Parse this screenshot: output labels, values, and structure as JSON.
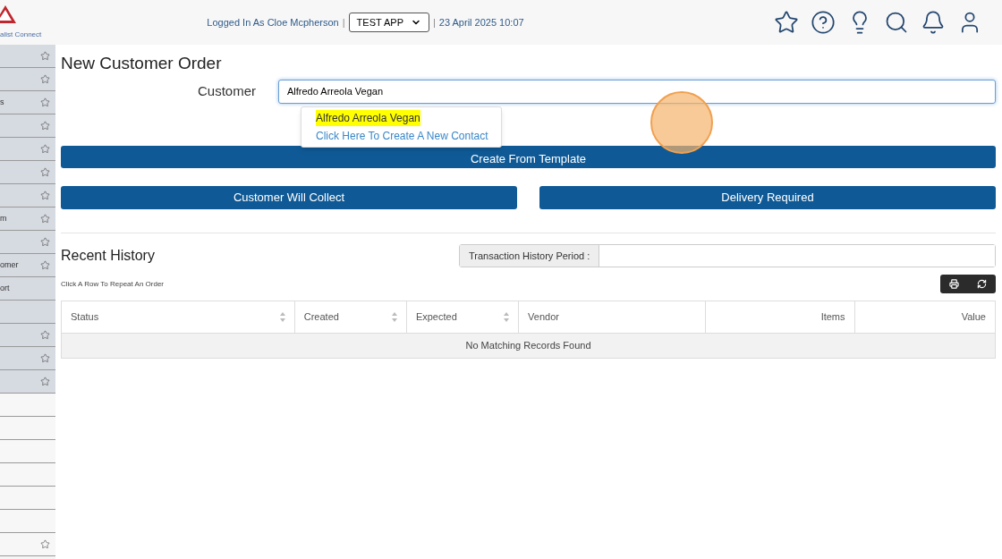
{
  "header": {
    "logo_caption": "alist Connect",
    "logged_in": "Logged In As Cloe Mcpherson",
    "separator_1": "|",
    "app_select": "TEST APP",
    "separator_2": "|",
    "datetime": "23 April 2025 10:07"
  },
  "sidebar": {
    "items": [
      {
        "shaded": true,
        "star": true
      },
      {
        "shaded": true,
        "star": true
      },
      {
        "label": "s",
        "shaded": true,
        "star": true
      },
      {
        "shaded": true,
        "star": true
      },
      {
        "shaded": true,
        "star": true
      },
      {
        "shaded": true,
        "star": true
      },
      {
        "shaded": true,
        "star": true
      },
      {
        "label": "m",
        "shaded": true,
        "star": true
      },
      {
        "shaded": true,
        "star": true
      },
      {
        "label": "omer",
        "shaded": true,
        "star": true
      },
      {
        "label": "ort",
        "shaded": true,
        "star": false
      },
      {
        "shaded": true,
        "star": false
      },
      {
        "shaded": true,
        "star": true
      },
      {
        "shaded": true,
        "star": true
      },
      {
        "shaded": true,
        "star": true
      },
      {
        "shaded": false,
        "star": false
      },
      {
        "shaded": false,
        "star": false
      },
      {
        "shaded": false,
        "star": false
      },
      {
        "shaded": false,
        "star": false
      },
      {
        "shaded": false,
        "star": false
      },
      {
        "shaded": false,
        "star": false
      },
      {
        "shaded": false,
        "star": true
      }
    ]
  },
  "page": {
    "title": "New Customer Order",
    "customer_label": "Customer",
    "customer_value": "Alfredo Arreola Vegan",
    "suggestions": [
      {
        "label": "Alfredo Arreola Vegan",
        "selected": true
      },
      {
        "label": "Click Here To Create A New Contact",
        "selected": false
      }
    ],
    "template_button": "Create From Template",
    "collect_button": "Customer Will Collect",
    "delivery_button": "Delivery Required"
  },
  "history": {
    "title": "Recent History",
    "hint": "Click A Row To Repeat An Order",
    "period_label": "Transaction History Period :",
    "columns": [
      {
        "label": "Status",
        "sortable": true
      },
      {
        "label": "Created",
        "sortable": true
      },
      {
        "label": "Expected",
        "sortable": true
      },
      {
        "label": "Vendor",
        "sortable": false
      },
      {
        "label": "Items",
        "sortable": false
      },
      {
        "label": "Value",
        "sortable": false
      }
    ],
    "empty_message": "No Matching Records Found"
  }
}
